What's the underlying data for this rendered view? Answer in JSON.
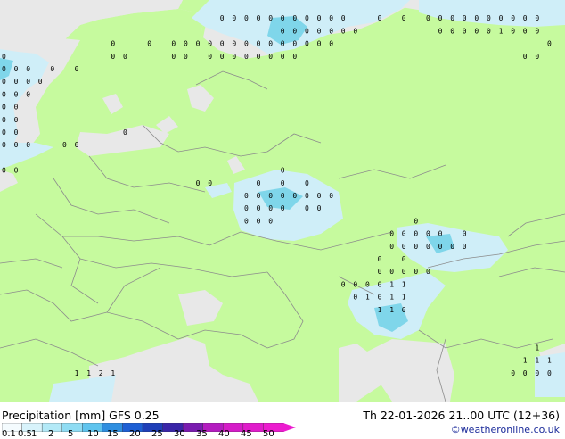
{
  "colors": {
    "sea": "#e8e8e8",
    "land": "#c6fa9e",
    "border": "#8c8c8c",
    "precip_light": "#cfeef8",
    "precip_medium": "#aee6f2",
    "precip_heavy": "#7fd6ea",
    "value_text": "#000000"
  },
  "footer": {
    "title": "Precipitation [mm]  GFS 0.25",
    "timestamp": "Th 22-01-2026 21..00 UTC (12+36)",
    "credit": "©weatheronline.co.uk"
  },
  "legend": {
    "ticks": [
      "0.1",
      "0.5",
      "1",
      "2",
      "5",
      "10",
      "15",
      "20",
      "25",
      "30",
      "35",
      "40",
      "45",
      "50"
    ],
    "colors": [
      "#f4fbfe",
      "#d8f3fb",
      "#b3e9f7",
      "#8fdcf3",
      "#5fc4ee",
      "#2f8fe0",
      "#1e5fd4",
      "#1f3fb8",
      "#3a26a8",
      "#7a1cb0",
      "#b41cc0",
      "#d51cc8",
      "#e01ccb",
      "#ec1ccf"
    ]
  },
  "precip_values": [
    {
      "col": 18,
      "row": 1,
      "value": "0"
    },
    {
      "col": 19,
      "row": 1,
      "value": "0"
    },
    {
      "col": 20,
      "row": 1,
      "value": "0"
    },
    {
      "col": 21,
      "row": 1,
      "value": "0"
    },
    {
      "col": 22,
      "row": 1,
      "value": "0"
    },
    {
      "col": 23,
      "row": 1,
      "value": "0"
    },
    {
      "col": 24,
      "row": 1,
      "value": "0"
    },
    {
      "col": 25,
      "row": 1,
      "value": "0"
    },
    {
      "col": 26,
      "row": 1,
      "value": "0"
    },
    {
      "col": 27,
      "row": 1,
      "value": "0"
    },
    {
      "col": 28,
      "row": 1,
      "value": "0"
    },
    {
      "col": 31,
      "row": 1,
      "value": "0"
    },
    {
      "col": 33,
      "row": 1,
      "value": "0"
    },
    {
      "col": 35,
      "row": 1,
      "value": "0"
    },
    {
      "col": 36,
      "row": 1,
      "value": "0"
    },
    {
      "col": 37,
      "row": 1,
      "value": "0"
    },
    {
      "col": 38,
      "row": 1,
      "value": "0"
    },
    {
      "col": 39,
      "row": 1,
      "value": "0"
    },
    {
      "col": 40,
      "row": 1,
      "value": "0"
    },
    {
      "col": 41,
      "row": 1,
      "value": "0"
    },
    {
      "col": 42,
      "row": 1,
      "value": "0"
    },
    {
      "col": 43,
      "row": 1,
      "value": "0"
    },
    {
      "col": 44,
      "row": 1,
      "value": "0"
    },
    {
      "col": 23,
      "row": 2,
      "value": "0"
    },
    {
      "col": 24,
      "row": 2,
      "value": "0"
    },
    {
      "col": 25,
      "row": 2,
      "value": "0"
    },
    {
      "col": 26,
      "row": 2,
      "value": "0"
    },
    {
      "col": 27,
      "row": 2,
      "value": "0"
    },
    {
      "col": 28,
      "row": 2,
      "value": "0"
    },
    {
      "col": 29,
      "row": 2,
      "value": "0"
    },
    {
      "col": 36,
      "row": 2,
      "value": "0"
    },
    {
      "col": 37,
      "row": 2,
      "value": "0"
    },
    {
      "col": 38,
      "row": 2,
      "value": "0"
    },
    {
      "col": 39,
      "row": 2,
      "value": "0"
    },
    {
      "col": 40,
      "row": 2,
      "value": "0"
    },
    {
      "col": 41,
      "row": 2,
      "value": "1"
    },
    {
      "col": 42,
      "row": 2,
      "value": "0"
    },
    {
      "col": 43,
      "row": 2,
      "value": "0"
    },
    {
      "col": 44,
      "row": 2,
      "value": "0"
    },
    {
      "col": 9,
      "row": 3,
      "value": "0"
    },
    {
      "col": 12,
      "row": 3,
      "value": "0"
    },
    {
      "col": 14,
      "row": 3,
      "value": "0"
    },
    {
      "col": 15,
      "row": 3,
      "value": "0"
    },
    {
      "col": 16,
      "row": 3,
      "value": "0"
    },
    {
      "col": 17,
      "row": 3,
      "value": "0"
    },
    {
      "col": 18,
      "row": 3,
      "value": "0"
    },
    {
      "col": 19,
      "row": 3,
      "value": "0"
    },
    {
      "col": 20,
      "row": 3,
      "value": "0"
    },
    {
      "col": 21,
      "row": 3,
      "value": "0"
    },
    {
      "col": 22,
      "row": 3,
      "value": "0"
    },
    {
      "col": 23,
      "row": 3,
      "value": "0"
    },
    {
      "col": 24,
      "row": 3,
      "value": "0"
    },
    {
      "col": 25,
      "row": 3,
      "value": "0"
    },
    {
      "col": 26,
      "row": 3,
      "value": "0"
    },
    {
      "col": 27,
      "row": 3,
      "value": "0"
    },
    {
      "col": 45,
      "row": 3,
      "value": "0"
    },
    {
      "col": 0,
      "row": 4,
      "value": "0"
    },
    {
      "col": 9,
      "row": 4,
      "value": "0"
    },
    {
      "col": 10,
      "row": 4,
      "value": "0"
    },
    {
      "col": 14,
      "row": 4,
      "value": "0"
    },
    {
      "col": 15,
      "row": 4,
      "value": "0"
    },
    {
      "col": 17,
      "row": 4,
      "value": "0"
    },
    {
      "col": 18,
      "row": 4,
      "value": "0"
    },
    {
      "col": 19,
      "row": 4,
      "value": "0"
    },
    {
      "col": 20,
      "row": 4,
      "value": "0"
    },
    {
      "col": 21,
      "row": 4,
      "value": "0"
    },
    {
      "col": 22,
      "row": 4,
      "value": "0"
    },
    {
      "col": 23,
      "row": 4,
      "value": "0"
    },
    {
      "col": 24,
      "row": 4,
      "value": "0"
    },
    {
      "col": 43,
      "row": 4,
      "value": "0"
    },
    {
      "col": 44,
      "row": 4,
      "value": "0"
    },
    {
      "col": 0,
      "row": 5,
      "value": "0"
    },
    {
      "col": 1,
      "row": 5,
      "value": "0"
    },
    {
      "col": 2,
      "row": 5,
      "value": "0"
    },
    {
      "col": 4,
      "row": 5,
      "value": "0"
    },
    {
      "col": 6,
      "row": 5,
      "value": "0"
    },
    {
      "col": 0,
      "row": 6,
      "value": "0"
    },
    {
      "col": 1,
      "row": 6,
      "value": "0"
    },
    {
      "col": 2,
      "row": 6,
      "value": "0"
    },
    {
      "col": 3,
      "row": 6,
      "value": "0"
    },
    {
      "col": 0,
      "row": 7,
      "value": "0"
    },
    {
      "col": 1,
      "row": 7,
      "value": "0"
    },
    {
      "col": 2,
      "row": 7,
      "value": "0"
    },
    {
      "col": 0,
      "row": 8,
      "value": "0"
    },
    {
      "col": 1,
      "row": 8,
      "value": "0"
    },
    {
      "col": 0,
      "row": 9,
      "value": "0"
    },
    {
      "col": 1,
      "row": 9,
      "value": "0"
    },
    {
      "col": 0,
      "row": 10,
      "value": "0"
    },
    {
      "col": 1,
      "row": 10,
      "value": "0"
    },
    {
      "col": 10,
      "row": 10,
      "value": "0"
    },
    {
      "col": 0,
      "row": 11,
      "value": "0"
    },
    {
      "col": 1,
      "row": 11,
      "value": "0"
    },
    {
      "col": 2,
      "row": 11,
      "value": "0"
    },
    {
      "col": 5,
      "row": 11,
      "value": "0"
    },
    {
      "col": 6,
      "row": 11,
      "value": "0"
    },
    {
      "col": 0,
      "row": 13,
      "value": "0"
    },
    {
      "col": 1,
      "row": 13,
      "value": "0"
    },
    {
      "col": 23,
      "row": 13,
      "value": "0"
    },
    {
      "col": 16,
      "row": 14,
      "value": "0"
    },
    {
      "col": 17,
      "row": 14,
      "value": "0"
    },
    {
      "col": 21,
      "row": 14,
      "value": "0"
    },
    {
      "col": 23,
      "row": 14,
      "value": "0"
    },
    {
      "col": 25,
      "row": 14,
      "value": "0"
    },
    {
      "col": 20,
      "row": 15,
      "value": "0"
    },
    {
      "col": 21,
      "row": 15,
      "value": "0"
    },
    {
      "col": 22,
      "row": 15,
      "value": "0"
    },
    {
      "col": 23,
      "row": 15,
      "value": "0"
    },
    {
      "col": 24,
      "row": 15,
      "value": "0"
    },
    {
      "col": 25,
      "row": 15,
      "value": "0"
    },
    {
      "col": 26,
      "row": 15,
      "value": "0"
    },
    {
      "col": 27,
      "row": 15,
      "value": "0"
    },
    {
      "col": 20,
      "row": 16,
      "value": "0"
    },
    {
      "col": 21,
      "row": 16,
      "value": "0"
    },
    {
      "col": 22,
      "row": 16,
      "value": "0"
    },
    {
      "col": 23,
      "row": 16,
      "value": "0"
    },
    {
      "col": 25,
      "row": 16,
      "value": "0"
    },
    {
      "col": 26,
      "row": 16,
      "value": "0"
    },
    {
      "col": 20,
      "row": 17,
      "value": "0"
    },
    {
      "col": 21,
      "row": 17,
      "value": "0"
    },
    {
      "col": 22,
      "row": 17,
      "value": "0"
    },
    {
      "col": 34,
      "row": 17,
      "value": "0"
    },
    {
      "col": 32,
      "row": 18,
      "value": "0"
    },
    {
      "col": 33,
      "row": 18,
      "value": "0"
    },
    {
      "col": 34,
      "row": 18,
      "value": "0"
    },
    {
      "col": 35,
      "row": 18,
      "value": "0"
    },
    {
      "col": 36,
      "row": 18,
      "value": "0"
    },
    {
      "col": 38,
      "row": 18,
      "value": "0"
    },
    {
      "col": 32,
      "row": 19,
      "value": "0"
    },
    {
      "col": 33,
      "row": 19,
      "value": "0"
    },
    {
      "col": 34,
      "row": 19,
      "value": "0"
    },
    {
      "col": 35,
      "row": 19,
      "value": "0"
    },
    {
      "col": 36,
      "row": 19,
      "value": "0"
    },
    {
      "col": 37,
      "row": 19,
      "value": "0"
    },
    {
      "col": 38,
      "row": 19,
      "value": "0"
    },
    {
      "col": 31,
      "row": 20,
      "value": "0"
    },
    {
      "col": 33,
      "row": 20,
      "value": "0"
    },
    {
      "col": 31,
      "row": 21,
      "value": "0"
    },
    {
      "col": 32,
      "row": 21,
      "value": "0"
    },
    {
      "col": 33,
      "row": 21,
      "value": "0"
    },
    {
      "col": 34,
      "row": 21,
      "value": "0"
    },
    {
      "col": 35,
      "row": 21,
      "value": "0"
    },
    {
      "col": 28,
      "row": 22,
      "value": "0"
    },
    {
      "col": 29,
      "row": 22,
      "value": "0"
    },
    {
      "col": 30,
      "row": 22,
      "value": "0"
    },
    {
      "col": 31,
      "row": 22,
      "value": "0"
    },
    {
      "col": 32,
      "row": 22,
      "value": "1"
    },
    {
      "col": 33,
      "row": 22,
      "value": "1"
    },
    {
      "col": 29,
      "row": 23,
      "value": "0"
    },
    {
      "col": 30,
      "row": 23,
      "value": "1"
    },
    {
      "col": 31,
      "row": 23,
      "value": "0"
    },
    {
      "col": 32,
      "row": 23,
      "value": "1"
    },
    {
      "col": 33,
      "row": 23,
      "value": "1"
    },
    {
      "col": 31,
      "row": 24,
      "value": "1"
    },
    {
      "col": 32,
      "row": 24,
      "value": "1"
    },
    {
      "col": 33,
      "row": 24,
      "value": "0"
    },
    {
      "col": 44,
      "row": 27,
      "value": "1"
    },
    {
      "col": 43,
      "row": 28,
      "value": "1"
    },
    {
      "col": 44,
      "row": 28,
      "value": "1"
    },
    {
      "col": 45,
      "row": 28,
      "value": "1"
    },
    {
      "col": 6,
      "row": 29,
      "value": "1"
    },
    {
      "col": 7,
      "row": 29,
      "value": "1"
    },
    {
      "col": 8,
      "row": 29,
      "value": "2"
    },
    {
      "col": 9,
      "row": 29,
      "value": "1"
    },
    {
      "col": 42,
      "row": 29,
      "value": "0"
    },
    {
      "col": 43,
      "row": 29,
      "value": "0"
    },
    {
      "col": 44,
      "row": 29,
      "value": "0"
    },
    {
      "col": 45,
      "row": 29,
      "value": "0"
    }
  ]
}
